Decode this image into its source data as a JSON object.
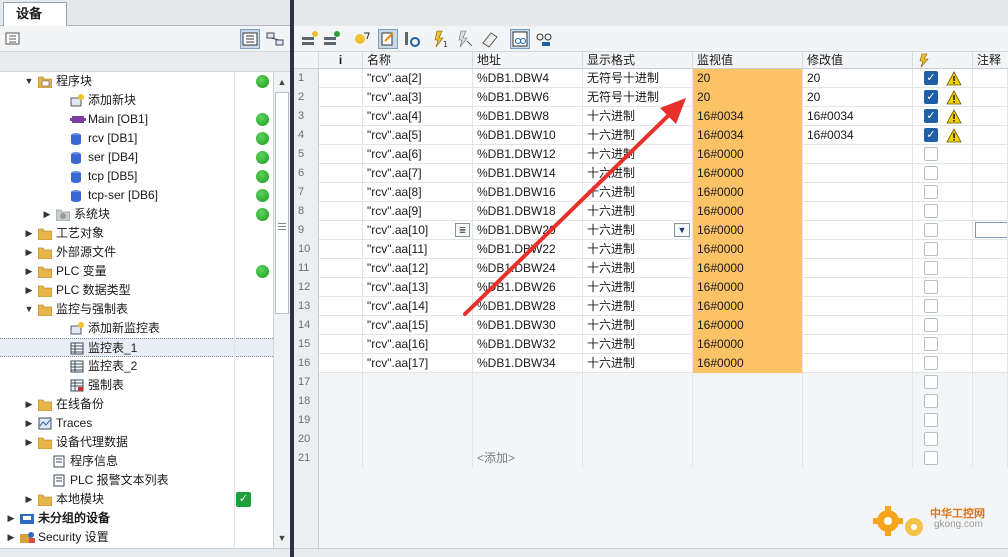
{
  "left_panel": {
    "tab": "设备",
    "tree": [
      {
        "label": "程序块",
        "status": "ok"
      },
      {
        "label": "添加新块",
        "status": ""
      },
      {
        "label": "Main [OB1]",
        "status": "ok"
      },
      {
        "label": "rcv [DB1]",
        "status": "ok"
      },
      {
        "label": "ser [DB4]",
        "status": "ok"
      },
      {
        "label": "tcp [DB5]",
        "status": "ok"
      },
      {
        "label": "tcp-ser [DB6]",
        "status": "ok"
      },
      {
        "label": "系统块",
        "status": "ok"
      },
      {
        "label": "工艺对象",
        "status": ""
      },
      {
        "label": "外部源文件",
        "status": ""
      },
      {
        "label": "PLC 变量",
        "status": "ok"
      },
      {
        "label": "PLC 数据类型",
        "status": ""
      },
      {
        "label": "监控与强制表",
        "status": ""
      },
      {
        "label": "添加新监控表",
        "status": ""
      },
      {
        "label": "监控表_1",
        "status": ""
      },
      {
        "label": "监控表_2",
        "status": ""
      },
      {
        "label": "强制表",
        "status": ""
      },
      {
        "label": "在线备份",
        "status": ""
      },
      {
        "label": "Traces",
        "status": ""
      },
      {
        "label": "设备代理数据",
        "status": ""
      },
      {
        "label": "程序信息",
        "status": ""
      },
      {
        "label": "PLC 报警文本列表",
        "status": ""
      },
      {
        "label": "本地模块",
        "status": "check"
      },
      {
        "label": "未分组的设备",
        "status": ""
      },
      {
        "label": "Security 设置",
        "status": ""
      }
    ]
  },
  "table": {
    "headers": {
      "i": "i",
      "name": "名称",
      "address": "地址",
      "format": "显示格式",
      "monitor": "监视值",
      "modify": "修改值",
      "comment": "注释"
    },
    "rows": [
      {
        "n": "1",
        "name": "\"rcv\".aa[2]",
        "address": "%DB1.DBW4",
        "format": "无符号十进制",
        "monitor": "20",
        "modify": "20",
        "checked": true,
        "warn": true
      },
      {
        "n": "2",
        "name": "\"rcv\".aa[3]",
        "address": "%DB1.DBW6",
        "format": "无符号十进制",
        "monitor": "20",
        "modify": "20",
        "checked": true,
        "warn": true
      },
      {
        "n": "3",
        "name": "\"rcv\".aa[4]",
        "address": "%DB1.DBW8",
        "format": "十六进制",
        "monitor": "16#0034",
        "modify": "16#0034",
        "checked": true,
        "warn": true
      },
      {
        "n": "4",
        "name": "\"rcv\".aa[5]",
        "address": "%DB1.DBW10",
        "format": "十六进制",
        "monitor": "16#0034",
        "modify": "16#0034",
        "checked": true,
        "warn": true
      },
      {
        "n": "5",
        "name": "\"rcv\".aa[6]",
        "address": "%DB1.DBW12",
        "format": "十六进制",
        "monitor": "16#0000",
        "modify": "",
        "checked": false,
        "warn": false
      },
      {
        "n": "6",
        "name": "\"rcv\".aa[7]",
        "address": "%DB1.DBW14",
        "format": "十六进制",
        "monitor": "16#0000",
        "modify": "",
        "checked": false,
        "warn": false
      },
      {
        "n": "7",
        "name": "\"rcv\".aa[8]",
        "address": "%DB1.DBW16",
        "format": "十六进制",
        "monitor": "16#0000",
        "modify": "",
        "checked": false,
        "warn": false
      },
      {
        "n": "8",
        "name": "\"rcv\".aa[9]",
        "address": "%DB1.DBW18",
        "format": "十六进制",
        "monitor": "16#0000",
        "modify": "",
        "checked": false,
        "warn": false
      },
      {
        "n": "9",
        "name": "\"rcv\".aa[10]",
        "address": "%DB1.DBW20",
        "format": "十六进制",
        "monitor": "16#0000",
        "modify": "",
        "checked": false,
        "warn": false
      },
      {
        "n": "10",
        "name": "\"rcv\".aa[11]",
        "address": "%DB1.DBW22",
        "format": "十六进制",
        "monitor": "16#0000",
        "modify": "",
        "checked": false,
        "warn": false
      },
      {
        "n": "11",
        "name": "\"rcv\".aa[12]",
        "address": "%DB1.DBW24",
        "format": "十六进制",
        "monitor": "16#0000",
        "modify": "",
        "checked": false,
        "warn": false
      },
      {
        "n": "12",
        "name": "\"rcv\".aa[13]",
        "address": "%DB1.DBW26",
        "format": "十六进制",
        "monitor": "16#0000",
        "modify": "",
        "checked": false,
        "warn": false
      },
      {
        "n": "13",
        "name": "\"rcv\".aa[14]",
        "address": "%DB1.DBW28",
        "format": "十六进制",
        "monitor": "16#0000",
        "modify": "",
        "checked": false,
        "warn": false
      },
      {
        "n": "14",
        "name": "\"rcv\".aa[15]",
        "address": "%DB1.DBW30",
        "format": "十六进制",
        "monitor": "16#0000",
        "modify": "",
        "checked": false,
        "warn": false
      },
      {
        "n": "15",
        "name": "\"rcv\".aa[16]",
        "address": "%DB1.DBW32",
        "format": "十六进制",
        "monitor": "16#0000",
        "modify": "",
        "checked": false,
        "warn": false
      },
      {
        "n": "16",
        "name": "\"rcv\".aa[17]",
        "address": "%DB1.DBW34",
        "format": "十六进制",
        "monitor": "16#0000",
        "modify": "",
        "checked": false,
        "warn": false
      }
    ],
    "empty_rows": [
      "17",
      "18",
      "19",
      "20",
      "21"
    ],
    "add_label": "<添加>"
  },
  "watermark": {
    "text1": "中华工控网",
    "text2": "gkong.com"
  },
  "colors": {
    "monitor_bg": "#fbc365",
    "checkbox_on": "#1f5fa8",
    "ok_dot": "#22aa22",
    "arrow": "#e8302a"
  }
}
